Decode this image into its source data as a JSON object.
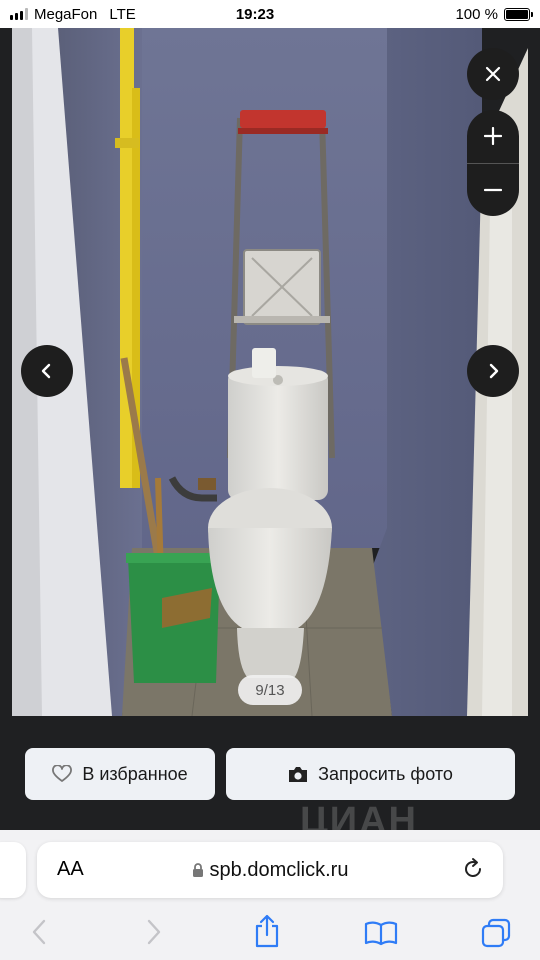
{
  "status_bar": {
    "carrier": "MegaFon",
    "network": "LTE",
    "time": "19:23",
    "battery": "100 %",
    "battery_level": 1.0
  },
  "viewer": {
    "counter": "9/13",
    "icons": {
      "close": "close-icon",
      "zoom_in": "plus-icon",
      "zoom_out": "minus-icon",
      "prev": "chevron-left-icon",
      "next": "chevron-right-icon"
    }
  },
  "actions": {
    "favorite_label": "В избранное",
    "request_photo_label": "Запросить фото",
    "watermark": "ЦИАН"
  },
  "safari": {
    "text_size_label": "AA",
    "url": "spb.domclick.ru"
  },
  "colors": {
    "viewer_bg": "#1f2022",
    "button_bg": "#eef1f5",
    "overlay_button": "#1e1e1e",
    "safari_bar": "#f2f2f4",
    "ios_blue": "#2f7cf6"
  }
}
